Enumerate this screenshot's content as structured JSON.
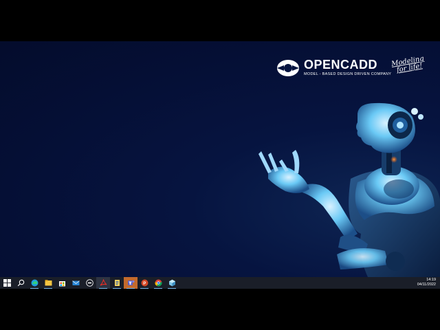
{
  "branding": {
    "wordmark": "OPENCADD",
    "subtitle": "MODEL - BASED DESIGN DRIVEN COMPANY",
    "tagline_line1": "Modeling",
    "tagline_line2": "for life!"
  },
  "taskbar": {
    "apps": [
      {
        "name": "start",
        "icon": "windows-logo-icon"
      },
      {
        "name": "search",
        "icon": "search-icon"
      },
      {
        "name": "edge",
        "icon": "edge-icon"
      },
      {
        "name": "file-explorer",
        "icon": "folder-icon"
      },
      {
        "name": "store",
        "icon": "store-icon"
      },
      {
        "name": "mail",
        "icon": "mail-icon"
      },
      {
        "name": "dell",
        "icon": "dell-icon"
      },
      {
        "name": "acrobat",
        "icon": "acrobat-icon"
      },
      {
        "name": "file-manager",
        "icon": "file-icon"
      },
      {
        "name": "teams",
        "icon": "teams-icon"
      },
      {
        "name": "powerpoint",
        "icon": "powerpoint-icon"
      },
      {
        "name": "chrome",
        "icon": "chrome-icon"
      },
      {
        "name": "app-cube",
        "icon": "cube-icon"
      }
    ],
    "clock": {
      "time": "14:19",
      "date": "04/11/2022"
    }
  },
  "colors": {
    "desktop_background": "#061440",
    "taskbar": "#1a1e28",
    "accent": "#76b9ed",
    "robot_glow": "#6ac9f5"
  }
}
